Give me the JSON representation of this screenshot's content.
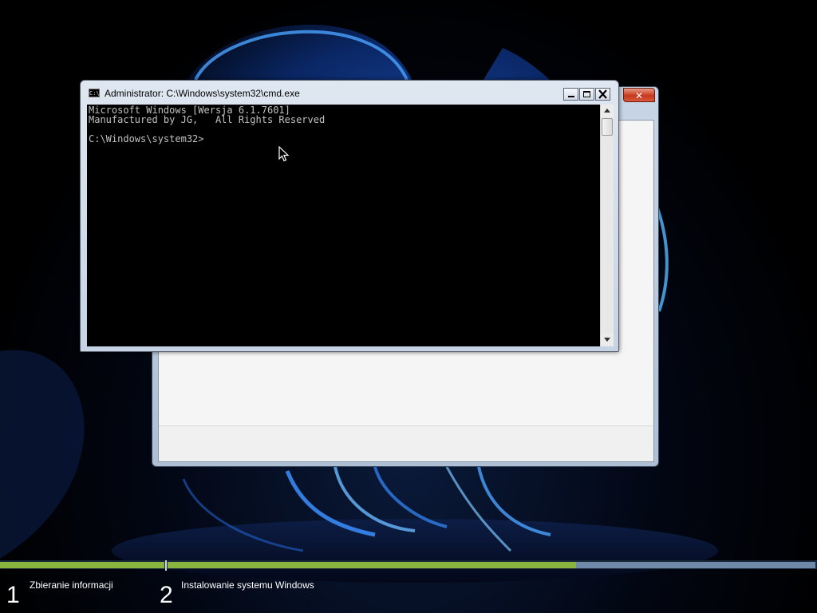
{
  "cmd_window": {
    "title": "Administrator: C:\\Windows\\system32\\cmd.exe",
    "icon_text": "C:\\",
    "console_lines": [
      "Microsoft Windows [Wersja 6.1.7601]",
      "Manufactured by JG,   All Rights Reserved",
      "",
      "C:\\Windows\\system32>"
    ]
  },
  "setup_window": {
    "close_glyph": "✕"
  },
  "progress": {
    "step2_fill_fraction": 0.63,
    "colors": {
      "done": "#89b43d",
      "remaining": "#6f8aa8"
    }
  },
  "steps": [
    {
      "number": "1",
      "label": "Zbieranie informacji"
    },
    {
      "number": "2",
      "label": "Instalowanie systemu Windows"
    }
  ],
  "icons": {
    "minimize": "minimize-icon",
    "maximize": "maximize-icon",
    "close": "close-icon",
    "scroll_up": "scroll-up-arrow-icon",
    "scroll_down": "scroll-down-arrow-icon",
    "cursor": "mouse-pointer-icon"
  }
}
